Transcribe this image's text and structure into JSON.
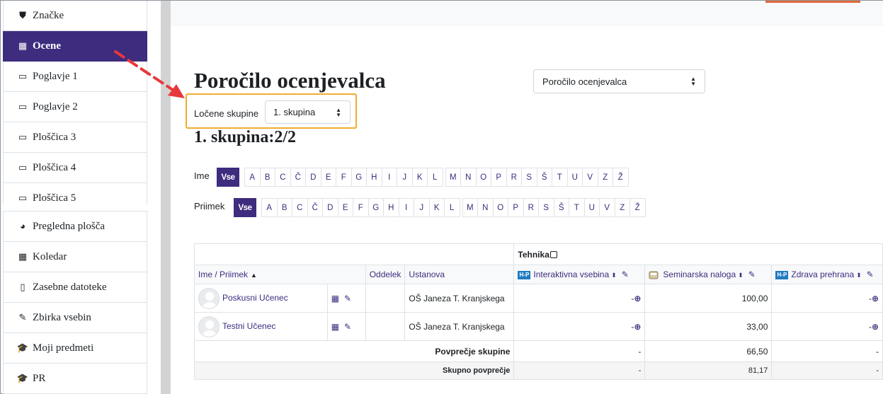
{
  "sidebar": {
    "items": [
      {
        "label": "Značke",
        "icon": "shield-icon",
        "glyph": "⛊",
        "active": false
      },
      {
        "label": "Ocene",
        "icon": "table-icon",
        "glyph": "▦",
        "active": true
      },
      {
        "label": "Poglavje 1",
        "icon": "folder-icon",
        "glyph": "▭",
        "active": false
      },
      {
        "label": "Poglavje 2",
        "icon": "folder-icon",
        "glyph": "▭",
        "active": false
      },
      {
        "label": "Ploščica 3",
        "icon": "folder-icon",
        "glyph": "▭",
        "active": false
      },
      {
        "label": "Ploščica 4",
        "icon": "folder-icon",
        "glyph": "▭",
        "active": false
      },
      {
        "label": "Ploščica 5",
        "icon": "folder-icon",
        "glyph": "▭",
        "active": false
      }
    ],
    "items2": [
      {
        "label": "Pregledna plošča",
        "icon": "dashboard-icon",
        "glyph": "◕"
      },
      {
        "label": "Koledar",
        "icon": "calendar-icon",
        "glyph": "▦"
      },
      {
        "label": "Zasebne datoteke",
        "icon": "file-icon",
        "glyph": "▯"
      },
      {
        "label": "Zbirka vsebin",
        "icon": "brush-icon",
        "glyph": "✎"
      },
      {
        "label": "Moji predmeti",
        "icon": "graduation-cap-icon",
        "glyph": "🎓"
      },
      {
        "label": "PR",
        "icon": "graduation-cap-icon",
        "glyph": "🎓"
      }
    ]
  },
  "page": {
    "title": "Poročilo ocenjevalca",
    "report_select": "Poročilo ocenjevalca",
    "group_label": "Ločene skupine",
    "group_select": "1. skupina",
    "group_heading": "1. skupina:2/2"
  },
  "initials": {
    "first_label": "Ime",
    "last_label": "Priimek",
    "all": "Vse",
    "letters": [
      "A",
      "B",
      "C",
      "Č",
      "D",
      "E",
      "F",
      "G",
      "H",
      "I",
      "J",
      "K",
      "L",
      "M",
      "N",
      "O",
      "P",
      "R",
      "S",
      "Š",
      "T",
      "U",
      "V",
      "Z",
      "Ž"
    ]
  },
  "table": {
    "category": "Tehnika",
    "col_name": "Ime / Priimek",
    "col_dept": "Oddelek",
    "col_inst": "Ustanova",
    "items": [
      {
        "label": "Interaktivna vsebina",
        "icon": "h5p-icon"
      },
      {
        "label": "Seminarska naloga",
        "icon": "assignment-icon"
      },
      {
        "label": "Zdrava prehrana",
        "icon": "h5p-icon"
      }
    ],
    "h5p_text": "H-P",
    "students": [
      {
        "name": "Poskusni Učenec",
        "inst": "OŠ Janeza T. Kranjskega",
        "g1": "-",
        "g2": "100,00",
        "g3": "-"
      },
      {
        "name": "Testni Učenec",
        "inst": "OŠ Janeza T. Kranjskega",
        "g1": "-",
        "g2": "33,00",
        "g3": "-"
      }
    ],
    "avg_label": "Povprečje skupine",
    "avg": {
      "g1": "-",
      "g2": "66,50",
      "g3": "-"
    },
    "total_label": "Skupno povprečje",
    "total": {
      "g1": "-",
      "g2": "81,17",
      "g3": "-"
    }
  }
}
